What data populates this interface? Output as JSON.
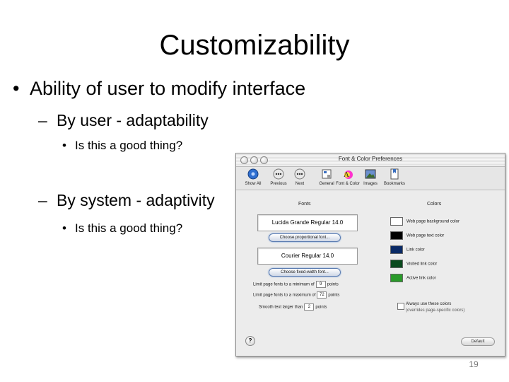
{
  "slide": {
    "title": "Customizability",
    "bullet1": "Ability of user to modify interface",
    "sub1": "By user - adaptability",
    "sub1_q": "Is this a good thing?",
    "sub2": "By system - adaptivity",
    "sub2_q": "Is this a good thing?",
    "page_number": "19",
    "bullet_glyph": "•",
    "dash_glyph": "–"
  },
  "window": {
    "title": "Font & Color Preferences",
    "toolbar": [
      {
        "label": "Show All",
        "icon": "show-all-icon"
      },
      {
        "label": "Previous",
        "icon": "previous-icon"
      },
      {
        "label": "Next",
        "icon": "next-icon"
      },
      {
        "label": "General",
        "icon": "general-icon"
      },
      {
        "label": "Font & Color",
        "icon": "font-color-icon"
      },
      {
        "label": "Images",
        "icon": "images-icon"
      },
      {
        "label": "Bookmarks",
        "icon": "bookmarks-icon"
      }
    ],
    "fonts": {
      "header": "Fonts",
      "proportional_value": "Lucida Grande Regular 14.0",
      "proportional_button": "Choose proportional font...",
      "fixed_value": "Courier Regular 14.0",
      "fixed_button": "Choose fixed-width font...",
      "min_label": "Limit page fonts to a minimum of",
      "min_value": "9",
      "min_unit": "points",
      "max_label": "Limit page fonts to a maximum of",
      "max_value": "72",
      "max_unit": "points",
      "smooth_label": "Smooth text larger than",
      "smooth_value": "2",
      "smooth_unit": "points"
    },
    "colors": {
      "header": "Colors",
      "items": [
        {
          "label": "Web page background color",
          "color": "#ffffff"
        },
        {
          "label": "Web page text color",
          "color": "#000000"
        },
        {
          "label": "Link color",
          "color": "#0a2a66"
        },
        {
          "label": "Visited link color",
          "color": "#0a4a1e"
        },
        {
          "label": "Active link color",
          "color": "#2a9a2a"
        }
      ],
      "always_use": "Always use these colors",
      "overrides": "(overrides page-specific colors)"
    },
    "help_label": "?",
    "default_button": "Default"
  }
}
